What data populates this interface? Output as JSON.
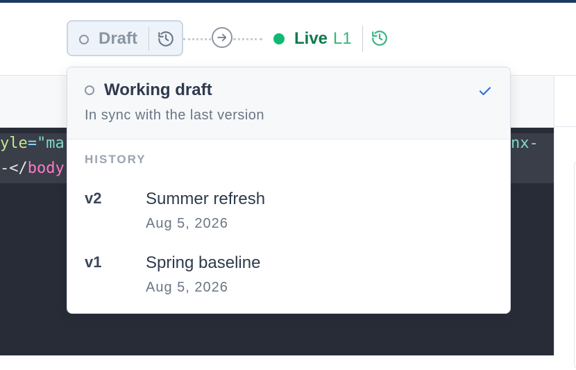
{
  "colors": {
    "accent_bar": "#1f3a5f",
    "draft_pill_bg": "#eef3f9",
    "live_green": "#10b971",
    "live_text": "#0e7a4b",
    "check_blue": "#2f6fe0",
    "editor_bg": "#282c36"
  },
  "status": {
    "draft_label": "Draft",
    "draft_history_icon": "history-icon",
    "connector_icon": "arrow-right-icon",
    "live_label": "Live",
    "live_level": "L1",
    "live_history_icon": "history-icon"
  },
  "editor": {
    "line1": {
      "attr": "yle",
      "eq": "=",
      "quote": "\"",
      "str": "ma",
      "tail": "nx-"
    },
    "line2": {
      "punct": "-</",
      "tag": "body"
    }
  },
  "dropdown": {
    "current": {
      "title": "Working draft",
      "subtitle": "In sync with the last version",
      "selected_icon": "check-icon"
    },
    "history_heading": "HISTORY",
    "history": [
      {
        "version": "v2",
        "name": "Summer refresh",
        "date": "Aug 5, 2026"
      },
      {
        "version": "v1",
        "name": "Spring baseline",
        "date": "Aug 5, 2026"
      }
    ]
  }
}
